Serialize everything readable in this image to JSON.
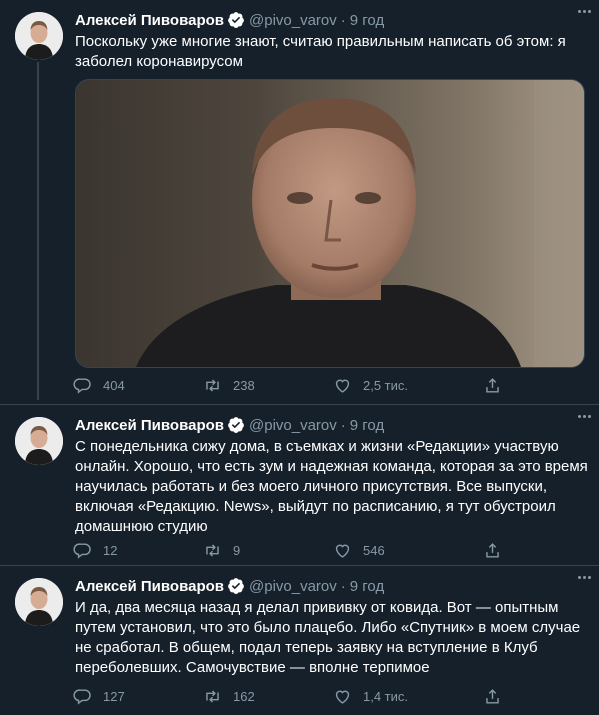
{
  "tweets": [
    {
      "name": "Алексей Пивоваров",
      "handle": "@pivo_varov",
      "dot": "·",
      "time": "9 год",
      "text": "Поскольку уже многие знают, считаю правильным написать об этом: я заболел коронавирусом",
      "replies": "404",
      "retweets": "238",
      "likes": "2,5 тис."
    },
    {
      "name": "Алексей Пивоваров",
      "handle": "@pivo_varov",
      "dot": "·",
      "time": "9 год",
      "text": "С понедельника сижу дома, в съемках и жизни «Редакции» участвую онлайн. Хорошо, что есть зум и надежная команда, которая за это время научилась работать и без моего личного присутствия. Все выпуски, включая «Редакцию. News», выйдут по расписанию, я тут обустроил домашнюю студию",
      "replies": "12",
      "retweets": "9",
      "likes": "546"
    },
    {
      "name": "Алексей Пивоваров",
      "handle": "@pivo_varov",
      "dot": "·",
      "time": "9 год",
      "text": "И да, два месяца назад я делал прививку от ковида. Вот — опытным путем установил, что это было плацебо. Либо «Спутник» в моем случае не сработал. В общем, подал теперь заявку на вступление в Клуб переболевших. Самочувствие — вполне терпимое",
      "replies": "127",
      "retweets": "162",
      "likes": "1,4 тис."
    }
  ],
  "colors": {
    "background": "#15202b",
    "secondary_text": "#8899a6",
    "verified": "#1da1f2",
    "divider": "#38444d"
  },
  "icons": [
    "verified-icon",
    "more-icon",
    "reply-icon",
    "retweet-icon",
    "like-icon",
    "share-icon"
  ]
}
